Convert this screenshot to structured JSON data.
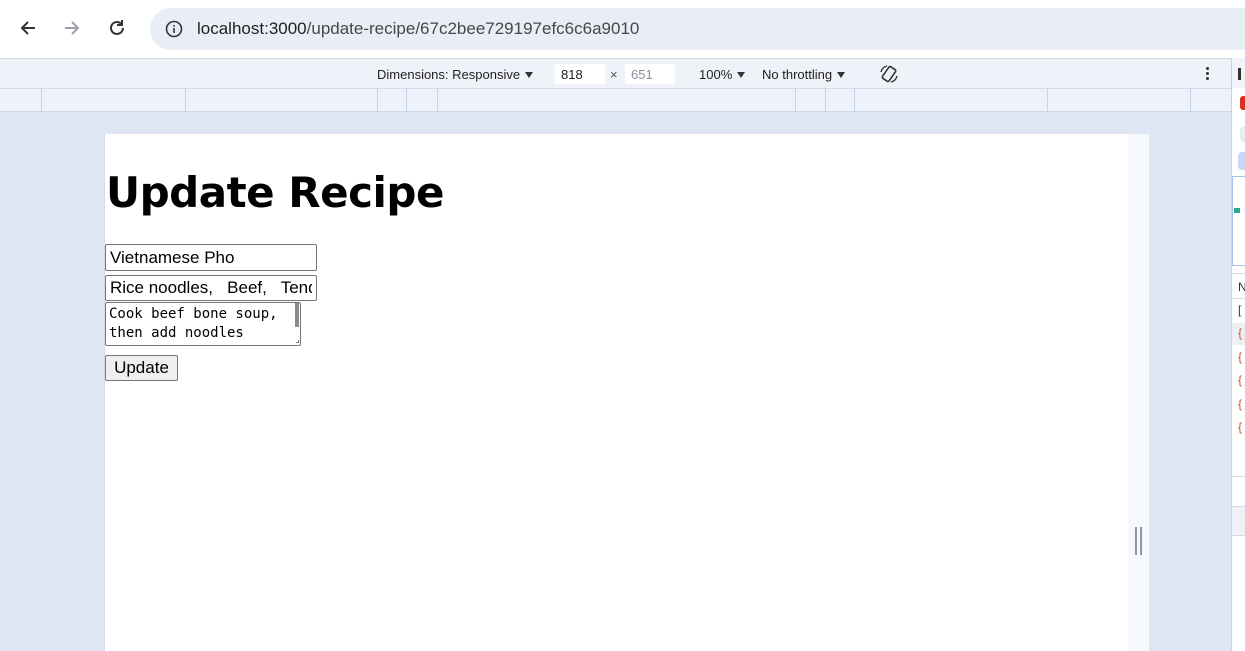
{
  "browser": {
    "url_host": "localhost:3000",
    "url_path": "/update-recipe/67c2bee729197efc6c6a9010",
    "icons": {
      "back": "arrow-left-icon",
      "forward": "arrow-right-icon",
      "reload": "reload-icon",
      "site_info": "info-icon"
    }
  },
  "device_toolbar": {
    "dimensions_label": "Dimensions: Responsive",
    "width_value": "818",
    "height_value": "651",
    "times": "×",
    "zoom_label": "100%",
    "throttling_label": "No throttling",
    "icons": {
      "rotate": "rotate-icon",
      "more": "more-vert-icon"
    }
  },
  "page": {
    "title": "Update Recipe",
    "name_value": "Vietnamese Pho",
    "ingredients_value": "Rice noodles,   Beef,   Tend",
    "instructions_value": "Cook beef bone soup,\nthen add noodles",
    "submit_label": "Update"
  },
  "colors": {
    "chrome_bg": "#ffffff",
    "address_bar": "#e9edf6",
    "devtools_bg": "#dfe6f3",
    "toolbar_bg": "#eff2f8"
  }
}
